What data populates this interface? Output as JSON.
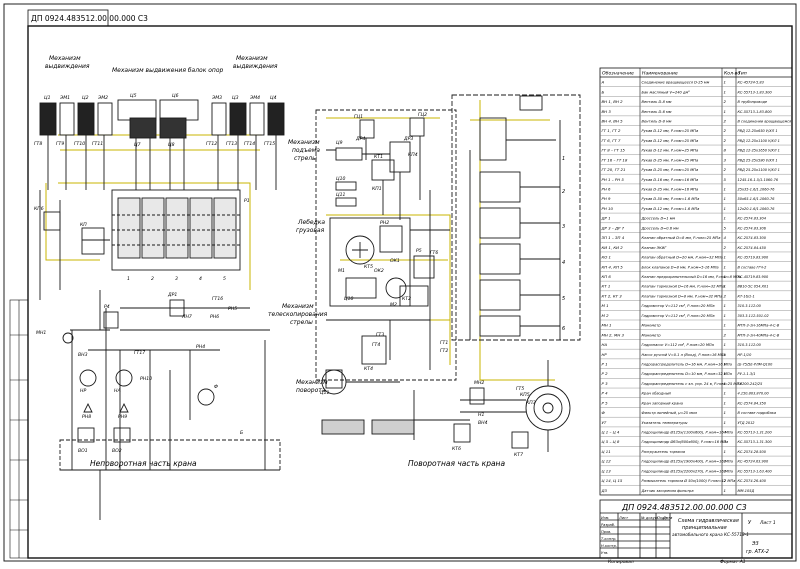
{
  "stamp": "ДП 0924.483512.00.00.000 С3",
  "mirror_stamp": "ДП 0924.483512.00.00.000 С3",
  "drawing_title": [
    "Схема гидравлическая",
    "принципиальная",
    "автомобильного крана КС-55713-1"
  ],
  "sheet_info": {
    "scale": "Э3",
    "group": "гр. АТХ-2"
  },
  "sections": {
    "left": "Неповоротная часть крана",
    "right": "Поворотная часть крана"
  },
  "mechanisms": {
    "outrigger_left": [
      "Механизм",
      "выдвиждения"
    ],
    "outrigger_beams": "Механизм выдвижения балок опор",
    "outrigger_right": [
      "Механизм",
      "выдвиждения"
    ],
    "boom_lift": [
      "Механизм",
      "подъема",
      "стрелы"
    ],
    "cargo_winch": [
      "Лебедка",
      "грузовая"
    ],
    "telescope": [
      "Механизм",
      "телескопирования",
      "стрелы"
    ],
    "slewing": [
      "Механизм",
      "поворота"
    ]
  },
  "component_labels": {
    "cylinders_left": [
      "Ц1",
      "ЭМ1",
      "Ц2",
      "ЭМ2"
    ],
    "cylinders_mid": [
      "Ц5",
      "Ц6",
      "Ц7",
      "Ц8"
    ],
    "cylinders_right": [
      "ЭМ3",
      "Ц3",
      "ЭМ4",
      "Ц4"
    ],
    "hoses_left": [
      "ГТ8",
      "ГТ9",
      "ГТ10",
      "ГТ11"
    ],
    "hoses_right": [
      "ГТ12",
      "ГТ13",
      "ГТ14",
      "ГТ15"
    ],
    "distributor": "Р1",
    "sections": [
      "1",
      "2",
      "3",
      "4",
      "5"
    ],
    "valves_left": [
      "КП6",
      "КП"
    ],
    "lower_left": [
      "МН1",
      "ВН3",
      "ГТ17",
      "НР",
      "НА",
      "РН10",
      "РН8",
      "РН9",
      "ВО1",
      "ВО2",
      "Б",
      "Ф",
      "Р4",
      "ДР1",
      "ГТ16",
      "ЛН7",
      "РН6",
      "РН5",
      "РН4"
    ],
    "right_top": [
      "ГЦ1",
      "ГЦ2",
      "ДР4",
      "ДР3",
      "КП4",
      "КП1",
      "КТ1",
      "Ц9",
      "Ц10",
      "Ц11"
    ],
    "right_mid": [
      "М1",
      "РН2",
      "КТ2",
      "ГТ6",
      "Р5",
      "ОК1",
      "ОК2",
      "КТ5",
      "ГТ1",
      "ГТ2"
    ],
    "right_low": [
      "Ц10",
      "М2",
      "ГТ3",
      "ГТ4",
      "КТ4",
      "МН2",
      "ГТ5",
      "КТ6",
      "Ц11",
      "КТ7",
      "КП5",
      "КП3",
      "Н1",
      "ВН4"
    ],
    "block_nums": [
      "1",
      "2",
      "3",
      "4",
      "5",
      "6"
    ]
  },
  "bom": {
    "headers": [
      "Обозначение",
      "Наименование",
      "Кол-во",
      "Тип"
    ],
    "rows": [
      [
        "А",
        "Соединение вращающееся D-25 мм",
        "1",
        "КС-45724-5.83"
      ],
      [
        "Б",
        "Бак масляный V=240 дм³",
        "1",
        "КС-55713-1.83.300"
      ],
      [
        "ВН 1, ВН 2",
        "Вентиль D-8 мм",
        "2",
        "В трубопроводе"
      ],
      [
        "ВН 3",
        "Вентиль D-6 мм",
        "1",
        "КС-55713-1.83.800"
      ],
      [
        "ВН 4, ВН 5",
        "Вентиль D-8 мм",
        "2",
        "В соединении вращающемся"
      ],
      [
        "ГТ 1, ГТ 2",
        "Рукав D-12 мм, Р.ном=25 МПа",
        "2",
        "РВД 12-25х650 У/ХЛ 1"
      ],
      [
        "ГТ 6, ГТ 7",
        "Рукав D-12 мм, Р.ном=25 МПа",
        "2",
        "РВД 12-25х1100 У/ХЛ 1"
      ],
      [
        "ГТ 8 – ГТ 15",
        "Рукав D-12 мм, Р.ном=25 МПа",
        "8",
        "РВД 12-25х1650 У/ХЛ 1"
      ],
      [
        "ГТ 16 – ГТ 18",
        "Рукав D-25 мм, Р.ном=25 МПа",
        "3",
        "РВД 25-25х580 У/ХЛ 1"
      ],
      [
        "ГТ 20, ГТ 21",
        "Рукав D-25 мм, Р.ном=25 МПа",
        "2",
        "РВД 25-25х1100 У/ХЛ 1"
      ],
      [
        "РН 1 – РН 5",
        "Рукав D-16 мм, Р.ном=16 МПа",
        "5",
        "1245-16-1.5/1.1060-76"
      ],
      [
        "РН 6",
        "Рукав D-25 мм, Р.ном=16 МПа",
        "1",
        "25х35-1.6/1.1060-76"
      ],
      [
        "РН 9",
        "Рукав D-50 мм, Р.ном=1.6 МПа",
        "1",
        "50х65-1.6/1.1060-76"
      ],
      [
        "РН 10",
        "Рукав D-12 мм, Р.ном=1.6 МПа",
        "1",
        "12х20-1.6/1.1060-76"
      ],
      [
        "ДР 1",
        "Дроссель D=1 мм",
        "1",
        "КС-2574.83.304"
      ],
      [
        "ДР 3 – ДР 7",
        "Дроссель D=0.6 мм",
        "5",
        "КС-2574.83.306"
      ],
      [
        "ЗП 1 – ЗП 4",
        "Клапан обратный D=8 мм, Р.ном=25 МПа",
        "4",
        "КС-2574.83.300"
      ],
      [
        "КИ 1, КИ 2",
        "Клапан ЭКИГ",
        "2",
        "КС-2574.84.450"
      ],
      [
        "КО 1",
        "Клапан обратный D=20 мм, Р.ном=32 МПа",
        "1",
        "КС-35719.83.900"
      ],
      [
        "КП 4, КП 5",
        "Блок клапанов D=8 мм, Р.ном=5-16 МПа",
        "1",
        "В составе ГГЧ-2"
      ],
      [
        "КП 6",
        "Клапан предохранительный D=16 мм, Р.ном=8 МПа",
        "1",
        "КС-45719.83.900"
      ],
      [
        "КТ 1",
        "Клапан тормозной D=16 мм, Р.ном=32 МПа",
        "1",
        "ВВ10-5С 054.Х01"
      ],
      [
        "КТ 2, КТ 3",
        "Клапан тормозной D=8 мм, Р.ном=32 МПа",
        "2",
        "КТ-16/1-1"
      ],
      [
        "М 1",
        "Гидромотор V=112 см³, Р.ном=20 МПа",
        "1",
        "310.3.112.00"
      ],
      [
        "М 2",
        "Гидромотор V=112 см³, Р.ном=20 МПа",
        "1",
        "303.3.112.501.02"
      ],
      [
        "МН 1",
        "Манометр",
        "1",
        "МТП-3-1Н-16МПа-4-С-В"
      ],
      [
        "МН 2, МН 3",
        "Манометр",
        "2",
        "МТП-3-1Н-40МПа-4-С-В"
      ],
      [
        "НА",
        "Гидронасос V=112 см³, Р.ном=20 МПа",
        "1",
        "310.3.112.00"
      ],
      [
        "НР",
        "Насос ручной V=0.1 л (Вход), Р.ном=16 МПа",
        "1",
        "НР-1/10"
      ],
      [
        "Р 1",
        "Гидрораспределитель D=16 мм, Р.ном=16 МПа",
        "1",
        "Ш-75/5Е-РЛМ-Q100"
      ],
      [
        "Р 2",
        "Гидрораспределитель D=10 мм, Р.ном=32 МПа",
        "1",
        "РУ-1.1-3/1"
      ],
      [
        "Р 3",
        "Гидрораспределитель с эл. упр. 24 в, Р.ном=25 МПа",
        "1",
        "ГЛ200-242/25"
      ],
      [
        "Р 4",
        "Кран обводный",
        "1",
        "4.150.803.870.00"
      ],
      [
        "Р 5",
        "Кран запорный крана",
        "1",
        "КС-2574.84.350"
      ],
      [
        "Ф",
        "Фильтр линейный, µ=25 мкм",
        "1",
        "В составе гидробака"
      ],
      [
        "УТ",
        "Указатель температуры",
        "1",
        "УТД 2012"
      ],
      [
        "Ц 1 – Ц 4",
        "Гидроцилиндр Ø125х(1100х600), Р.ном=16 МПа",
        "4",
        "КС-55713-1.31.200"
      ],
      [
        "Ц 5 – Ц 8",
        "Гидроцилиндр Ø63х(600х600), Р.ном=16 МПа",
        "4",
        "КС-55713-1.31.300"
      ],
      [
        "Ц 11",
        "Разгружатель тормоза",
        "1",
        "КС-2574.28.500"
      ],
      [
        "Ц 12",
        "Гидроцилиндр Ø125х(1900х400), Р.ном=16 МПа",
        "1",
        "КС-45724.63.900"
      ],
      [
        "Ц 13",
        "Гидроцилиндр Ø125х(2200х270), Р.ном=16 МПа",
        "1",
        "КС-55713-1.63.400"
      ],
      [
        "Ц 14, Ц 15",
        "Размыкатель тормоза Ø 50х(1000) Р.ном=12 МПа",
        "2",
        "КС-2574.26.400"
      ],
      [
        "Д3",
        "Датчик засорения фильтра",
        "1",
        "ММ-105Д"
      ]
    ]
  },
  "title_block": {
    "rows": [
      "Изм.",
      "Лист",
      "№ докум.",
      "Подп.",
      "Дата",
      "Разраб.",
      "Пров.",
      "Т.контр.",
      "Н.контр.",
      "Утв."
    ],
    "lit": "У",
    "sheet_label": "Лист 1"
  },
  "bottom_strip": [
    "Копировал",
    "Формат  А1"
  ],
  "colors": {
    "line": "#1a1a1a",
    "accent_yellow": "#c9b400",
    "paper": "#ffffff"
  }
}
